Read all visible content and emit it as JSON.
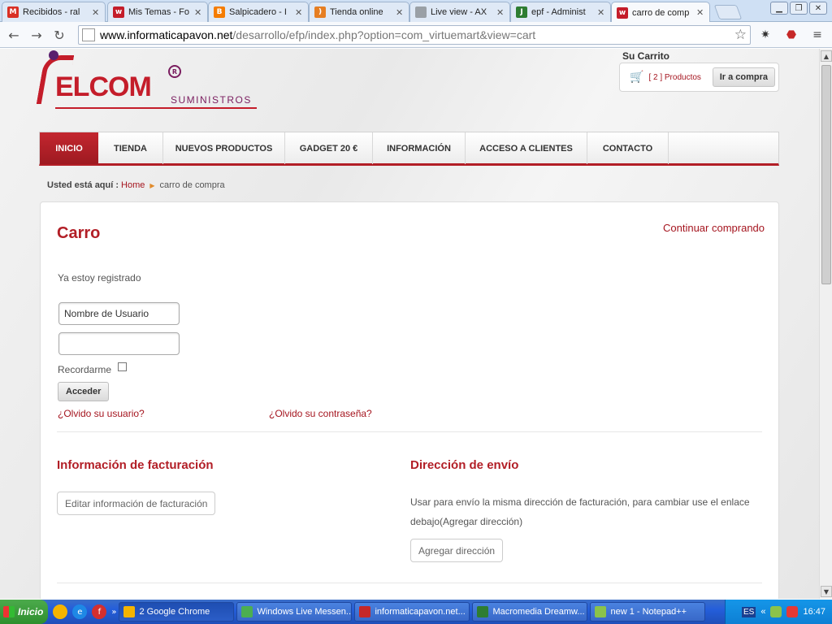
{
  "browser": {
    "tabs": [
      {
        "title": "Recibidos - ral",
        "icon": "gmail-icon",
        "color": "#d93025",
        "glyph": "M"
      },
      {
        "title": "Mis Temas - Fo",
        "icon": "telcom-icon",
        "color": "#c41d2a",
        "glyph": "w"
      },
      {
        "title": "Salpicadero - I",
        "icon": "blogger-icon",
        "color": "#f57c00",
        "glyph": "B"
      },
      {
        "title": "Tienda online",
        "icon": "radio-icon",
        "color": "#e67e22",
        "glyph": ")"
      },
      {
        "title": "Live view - AX",
        "icon": "page-icon",
        "color": "#9aa0a6",
        "glyph": ""
      },
      {
        "title": "epf - Administ",
        "icon": "joomla-icon",
        "color": "#2e7d32",
        "glyph": "J"
      },
      {
        "title": "carro de comp",
        "icon": "telcom-icon",
        "color": "#c41d2a",
        "glyph": "w",
        "active": true
      }
    ],
    "url_host": "www.informaticapavon.net",
    "url_path": "/desarrollo/efp/index.php?option=com_virtuemart&view=cart"
  },
  "header": {
    "logo_text": "ELCOM",
    "logo_sub": "SUMINISTROS",
    "logo_reg": "R",
    "cart_title": "Su Carrito",
    "cart_count": "[ 2 ] Productos",
    "cart_go": "Ir a compra"
  },
  "menu": [
    {
      "label": "INICIO",
      "active": true
    },
    {
      "label": "TIENDA"
    },
    {
      "label": "NUEVOS PRODUCTOS"
    },
    {
      "label": "GADGET 20 €"
    },
    {
      "label": "INFORMACIÓN"
    },
    {
      "label": "ACCESO A CLIENTES"
    },
    {
      "label": "CONTACTO"
    }
  ],
  "breadcrumb": {
    "label": "Usted está aquí :",
    "home": "Home",
    "current": "carro de compra"
  },
  "cart": {
    "title": "Carro",
    "continue": "Continuar comprando",
    "registered": "Ya estoy registrado",
    "username_placeholder": "Nombre de Usuario",
    "remember": "Recordarme",
    "login": "Acceder",
    "forgot_user": "¿Olvido su usuario?",
    "forgot_pass": "¿Olvido su contraseña?",
    "billing_title": "Información de facturación",
    "billing_edit": "Editar información de facturación",
    "shipping_title": "Dirección de envío",
    "shipping_text": "Usar para envío la misma dirección de facturación, para cambiar use el enlace debajo(Agregar dirección)",
    "shipping_add": "Agregar dirección"
  },
  "taskbar": {
    "start": "Inicio",
    "tasks": [
      {
        "label": "2 Google Chrome",
        "color": "#f4b400",
        "active": true
      },
      {
        "label": "Windows Live Messen...",
        "color": "#4caf50"
      },
      {
        "label": "informaticapavon.net...",
        "color": "#c62828"
      },
      {
        "label": "Macromedia Dreamw...",
        "color": "#2e7d32"
      },
      {
        "label": "new  1 - Notepad++",
        "color": "#8bc34a"
      }
    ],
    "lang": "ES",
    "time": "16:47"
  }
}
